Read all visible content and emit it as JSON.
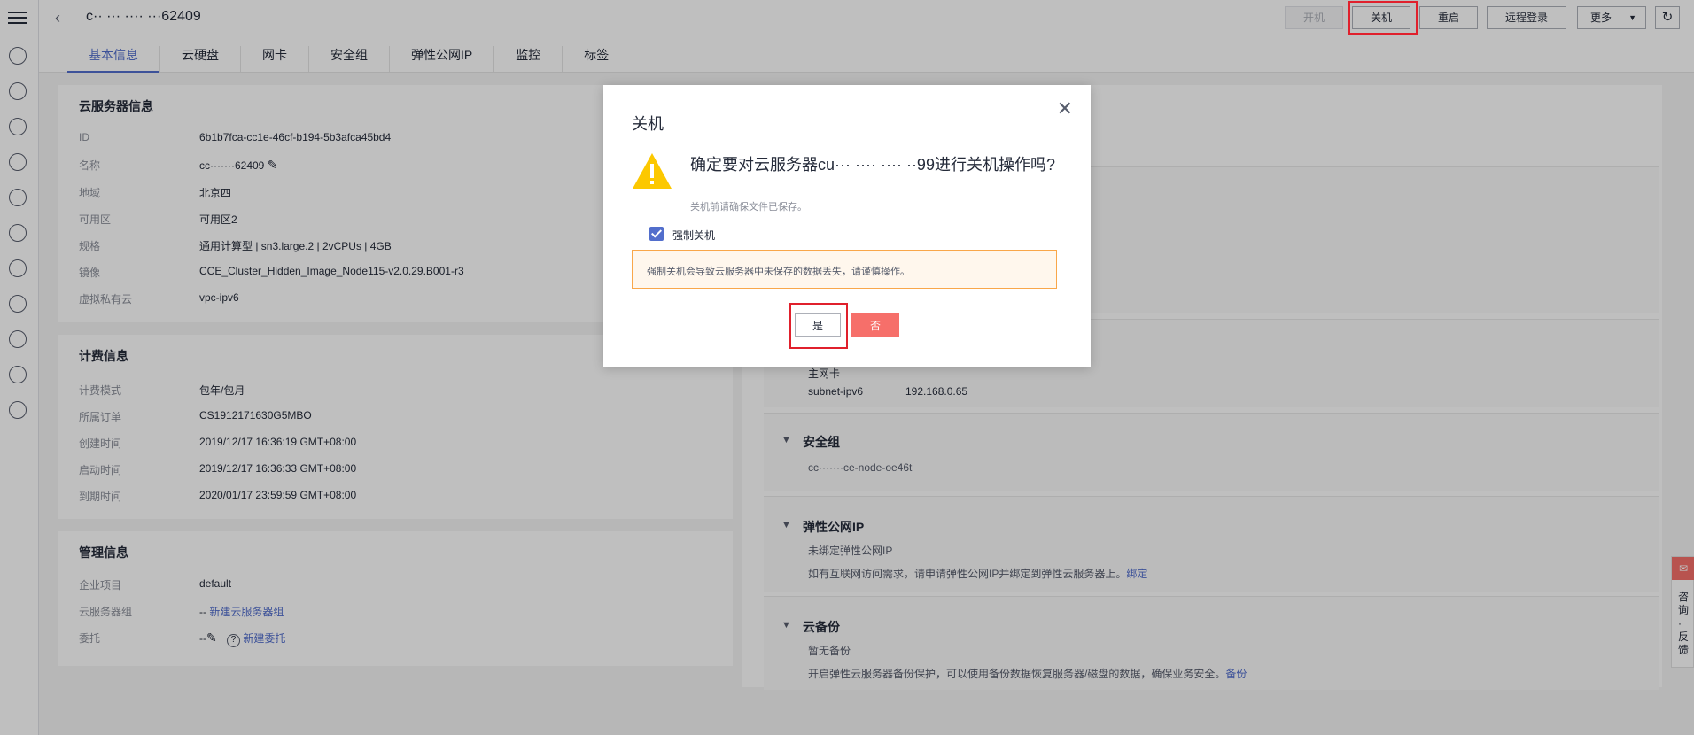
{
  "header": {
    "server_name": "c·· ··· ···· ···62409",
    "buttons": {
      "power_on": "开机",
      "power_off": "关机",
      "restart": "重启",
      "remote_login": "远程登录",
      "more": "更多"
    }
  },
  "tabs": [
    "基本信息",
    "云硬盘",
    "网卡",
    "安全组",
    "弹性公网IP",
    "监控",
    "标签"
  ],
  "server_info": {
    "title": "云服务器信息",
    "rows": [
      {
        "k": "ID",
        "v": "6b1b7fca-cc1e-46cf-b194-5b3afca45bd4"
      },
      {
        "k": "名称",
        "v": "cc·······62409"
      },
      {
        "k": "地域",
        "v": "北京四"
      },
      {
        "k": "可用区",
        "v": "可用区2"
      },
      {
        "k": "规格",
        "v": "通用计算型 | sn3.large.2 | 2vCPUs | 4GB"
      },
      {
        "k": "镜像",
        "v": "CCE_Cluster_Hidden_Image_Node115-v2.0.29.B001-r3"
      },
      {
        "k": "虚拟私有云",
        "v": "vpc-ipv6"
      }
    ]
  },
  "billing_info": {
    "title": "计费信息",
    "rows": [
      {
        "k": "计费模式",
        "v": "包年/包月"
      },
      {
        "k": "所属订单",
        "v": "CS1912171630G5MBO"
      },
      {
        "k": "创建时间",
        "v": "2019/12/17 16:36:19 GMT+08:00"
      },
      {
        "k": "启动时间",
        "v": "2019/12/17 16:36:33 GMT+08:00"
      },
      {
        "k": "到期时间",
        "v": "2020/01/17 23:59:59 GMT+08:00"
      }
    ]
  },
  "mgmt_info": {
    "title": "管理信息",
    "rows": [
      {
        "k": "企业项目",
        "v": "default"
      },
      {
        "k": "云服务器组",
        "v": "--",
        "link": "新建云服务器组"
      },
      {
        "k": "委托",
        "v": "--",
        "link": "新建委托"
      }
    ]
  },
  "right": {
    "nic": {
      "primary": "主网卡",
      "subnet": "subnet-ipv6",
      "ip": "192.168.0.65"
    },
    "security_group": {
      "title": "安全组",
      "name": "cc·······ce-node-oe46t"
    },
    "eip": {
      "title": "弹性公网IP",
      "status": "未绑定弹性公网IP",
      "hint": "如有互联网访问需求，请申请弹性公网IP并绑定到弹性云服务器上。",
      "link": "绑定"
    },
    "backup": {
      "title": "云备份",
      "status": "暂无备份",
      "hint": "开启弹性云服务器备份保护，可以使用备份数据恢复服务器/磁盘的数据，确保业务安全。",
      "link": "备份"
    }
  },
  "consult": {
    "label": "咨询·反馈"
  },
  "dialog": {
    "title": "关机",
    "message": "确定要对云服务器cu··· ···· ···· ··99进行关机操作吗?",
    "sub": "关机前请确保文件已保存。",
    "force_label": "强制关机",
    "alert": "强制关机会导致云服务器中未保存的数据丢失，请谨慎操作。",
    "yes": "是",
    "no": "否"
  }
}
